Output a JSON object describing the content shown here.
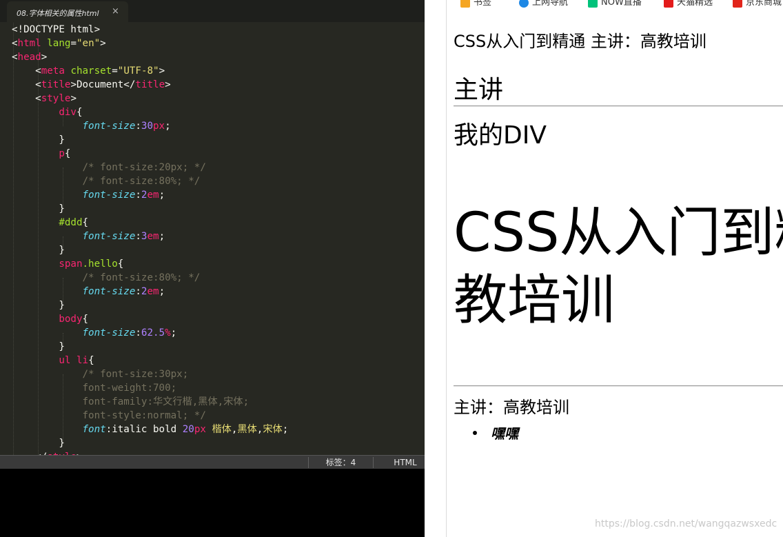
{
  "editor": {
    "tab": {
      "filename": "08.字体相关的属性html",
      "close_glyph": "×"
    },
    "dropdown_glyph": "▼",
    "theme": {
      "background": "#272822",
      "tag": "#f92672",
      "attr": "#a6e22e",
      "string": "#e6db74",
      "property": "#66d9ef",
      "number": "#ae81ff",
      "comment": "#75715e",
      "text": "#f8f8f2"
    },
    "lines": [
      [
        [
          "w",
          "<!DOCTYPE html>"
        ]
      ],
      [
        [
          "w",
          "<"
        ],
        [
          "t",
          "html"
        ],
        [
          "w",
          " "
        ],
        [
          "a",
          "lang"
        ],
        [
          "w",
          "="
        ],
        [
          "s",
          "\"en\""
        ],
        [
          "w",
          ">"
        ]
      ],
      [
        [
          "w",
          "<"
        ],
        [
          "t",
          "head"
        ],
        [
          "w",
          ">"
        ]
      ],
      [
        [
          "w",
          "    <"
        ],
        [
          "t",
          "meta"
        ],
        [
          "w",
          " "
        ],
        [
          "a",
          "charset"
        ],
        [
          "w",
          "="
        ],
        [
          "s",
          "\"UTF-8\""
        ],
        [
          "w",
          ">"
        ]
      ],
      [
        [
          "w",
          "    <"
        ],
        [
          "t",
          "title"
        ],
        [
          "w",
          ">Document</"
        ],
        [
          "t",
          "title"
        ],
        [
          "w",
          ">"
        ]
      ],
      [
        [
          "w",
          "    <"
        ],
        [
          "t",
          "style"
        ],
        [
          "w",
          ">"
        ]
      ],
      [
        [
          "w",
          "        "
        ],
        [
          "t",
          "div"
        ],
        [
          "w",
          "{"
        ]
      ],
      [
        [
          "w",
          "            "
        ],
        [
          "p",
          "font-size"
        ],
        [
          "w",
          ":"
        ],
        [
          "n",
          "30"
        ],
        [
          "t",
          "px"
        ],
        [
          "w",
          ";"
        ]
      ],
      [
        [
          "w",
          "        }"
        ]
      ],
      [
        [
          "w",
          "        "
        ],
        [
          "t",
          "p"
        ],
        [
          "w",
          "{"
        ]
      ],
      [
        [
          "w",
          "            "
        ],
        [
          "c",
          "/* font-size:20px; */"
        ]
      ],
      [
        [
          "w",
          "            "
        ],
        [
          "c",
          "/* font-size:80%; */"
        ]
      ],
      [
        [
          "w",
          "            "
        ],
        [
          "p",
          "font-size"
        ],
        [
          "w",
          ":"
        ],
        [
          "n",
          "2"
        ],
        [
          "t",
          "em"
        ],
        [
          "w",
          ";"
        ]
      ],
      [
        [
          "w",
          "        }"
        ]
      ],
      [
        [
          "w",
          "        "
        ],
        [
          "a",
          "#ddd"
        ],
        [
          "w",
          "{"
        ]
      ],
      [
        [
          "w",
          "            "
        ],
        [
          "p",
          "font-size"
        ],
        [
          "w",
          ":"
        ],
        [
          "n",
          "3"
        ],
        [
          "t",
          "em"
        ],
        [
          "w",
          ";"
        ]
      ],
      [
        [
          "w",
          "        }"
        ]
      ],
      [
        [
          "w",
          "        "
        ],
        [
          "t",
          "span"
        ],
        [
          "a",
          ".hello"
        ],
        [
          "w",
          "{"
        ]
      ],
      [
        [
          "w",
          "            "
        ],
        [
          "c",
          "/* font-size:80%; */"
        ]
      ],
      [
        [
          "w",
          "            "
        ],
        [
          "p",
          "font-size"
        ],
        [
          "w",
          ":"
        ],
        [
          "n",
          "2"
        ],
        [
          "t",
          "em"
        ],
        [
          "w",
          ";"
        ]
      ],
      [
        [
          "w",
          "        }"
        ]
      ],
      [
        [
          "w",
          "        "
        ],
        [
          "t",
          "body"
        ],
        [
          "w",
          "{"
        ]
      ],
      [
        [
          "w",
          "            "
        ],
        [
          "p",
          "font-size"
        ],
        [
          "w",
          ":"
        ],
        [
          "n",
          "62.5"
        ],
        [
          "t",
          "%"
        ],
        [
          "w",
          ";"
        ]
      ],
      [
        [
          "w",
          "        }"
        ]
      ],
      [
        [
          "w",
          "        "
        ],
        [
          "t",
          "ul li"
        ],
        [
          "w",
          "{"
        ]
      ],
      [
        [
          "w",
          "            "
        ],
        [
          "c",
          "/* font-size:30px;"
        ]
      ],
      [
        [
          "w",
          "            "
        ],
        [
          "c",
          "font-weight:700;"
        ]
      ],
      [
        [
          "w",
          "            "
        ],
        [
          "c",
          "font-family:华文行楷,黑体,宋体;"
        ]
      ],
      [
        [
          "w",
          "            "
        ],
        [
          "c",
          "font-style:normal; */"
        ]
      ],
      [
        [
          "w",
          "            "
        ],
        [
          "p",
          "font"
        ],
        [
          "w",
          ":italic bold "
        ],
        [
          "n",
          "20"
        ],
        [
          "t",
          "px"
        ],
        [
          "w",
          " "
        ],
        [
          "s",
          "楷体"
        ],
        [
          "w",
          ","
        ],
        [
          "s",
          "黑体"
        ],
        [
          "w",
          ","
        ],
        [
          "s",
          "宋体"
        ],
        [
          "w",
          ";"
        ]
      ],
      [
        [
          "w",
          "        }"
        ]
      ],
      [
        [
          "w",
          "    </"
        ],
        [
          "t",
          "style"
        ],
        [
          "w",
          ">"
        ]
      ]
    ],
    "status": {
      "tabs": "标签：4",
      "syntax": "HTML"
    }
  },
  "browser": {
    "bookmarks": [
      {
        "label": "书签",
        "icon_name": "star-icon",
        "color": "#f5a623"
      },
      {
        "label": "上网导航",
        "icon_name": "navigation-icon",
        "color": "#1e88e5"
      },
      {
        "label": "NOW直播",
        "icon_name": "live-icon",
        "color": "#00c27a"
      },
      {
        "label": "天猫精选",
        "icon_name": "tmall-icon",
        "color": "#e31b1b"
      },
      {
        "label": "京东商城",
        "icon_name": "jd-icon",
        "color": "#e1251b"
      }
    ],
    "content": {
      "p_text": "CSS从入门到精通 主讲：高教培训",
      "heading": "主讲",
      "div_text": "我的DIV",
      "big_line1": "CSS从入门到精",
      "big_line2": "教培训",
      "p_text2": "主讲：高教培训",
      "li_text": "嘿嘿"
    },
    "watermark": "https://blog.csdn.net/wangqazwsxedc"
  }
}
